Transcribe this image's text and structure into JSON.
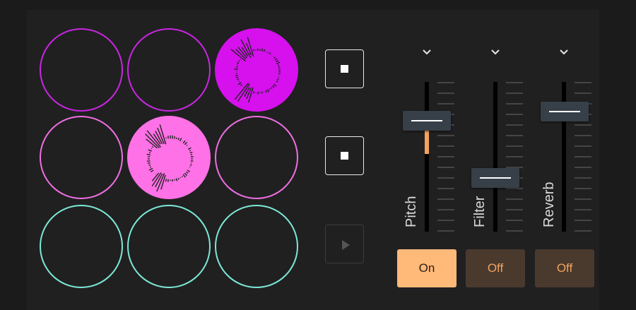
{
  "pads": [
    {
      "id": "pad-1",
      "row": 1,
      "col": 1,
      "active": false,
      "color": "#c926e0"
    },
    {
      "id": "pad-2",
      "row": 1,
      "col": 2,
      "active": false,
      "color": "#c926e0"
    },
    {
      "id": "pad-3",
      "row": 1,
      "col": 3,
      "active": true,
      "color": "#d611ee"
    },
    {
      "id": "pad-4",
      "row": 2,
      "col": 1,
      "active": false,
      "color": "#ee6fe0"
    },
    {
      "id": "pad-5",
      "row": 2,
      "col": 2,
      "active": true,
      "color": "#ff71e6"
    },
    {
      "id": "pad-6",
      "row": 2,
      "col": 3,
      "active": false,
      "color": "#ee6fe0"
    },
    {
      "id": "pad-7",
      "row": 3,
      "col": 1,
      "active": false,
      "color": "#7de8d6"
    },
    {
      "id": "pad-8",
      "row": 3,
      "col": 2,
      "active": false,
      "color": "#7de8d6"
    },
    {
      "id": "pad-9",
      "row": 3,
      "col": 3,
      "active": false,
      "color": "#7de8d6"
    }
  ],
  "row_controls": [
    {
      "icon": "stop-icon",
      "enabled": true
    },
    {
      "icon": "stop-icon",
      "enabled": true
    },
    {
      "icon": "play-icon",
      "enabled": false
    }
  ],
  "sliders": [
    {
      "label": "Pitch",
      "level": 0.74,
      "fill_from": 0.74,
      "fill_to": 0.52,
      "toggle_label": "On",
      "toggle_on": true
    },
    {
      "label": "Filter",
      "level": 0.36,
      "toggle_label": "Off",
      "toggle_on": false
    },
    {
      "label": "Reverb",
      "level": 0.8,
      "toggle_label": "Off",
      "toggle_on": false
    }
  ],
  "colors": {
    "accent": "#ffb978",
    "toggle_off_bg": "#4a3a2d",
    "toggle_off_text": "#f0a35f",
    "handle": "#374048"
  }
}
